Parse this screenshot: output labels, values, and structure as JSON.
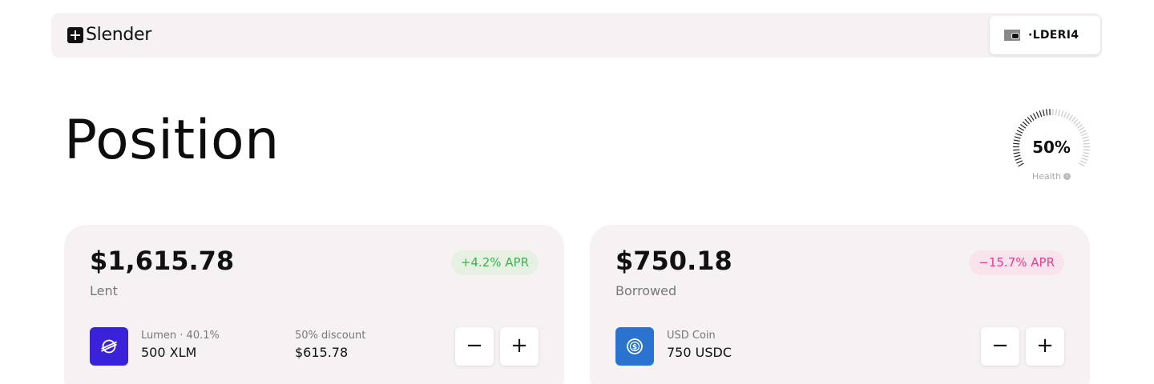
{
  "header": {
    "logo_text": "Slender",
    "wallet_address": "·LDERI4"
  },
  "page": {
    "title": "Position"
  },
  "health": {
    "value": "50%",
    "percent": 50,
    "label": "Health"
  },
  "lent": {
    "amount": "$1,615.78",
    "label": "Lent",
    "apr": "+4.2% APR",
    "asset_meta": "Lumen · 40.1%",
    "asset_amount": "500 XLM",
    "discount_label": "50% discount",
    "discount_value": "$615.78",
    "minus_label": "−",
    "plus_label": "+"
  },
  "borrowed": {
    "amount": "$750.18",
    "label": "Borrowed",
    "apr": "−15.7% APR",
    "asset_meta": "USD Coin",
    "asset_amount": "750 USDC",
    "minus_label": "−",
    "plus_label": "+"
  },
  "colors": {
    "apr_positive": "#3bb34a",
    "apr_negative": "#e0418b",
    "xlm_brand": "#3a22d9",
    "usdc_brand": "#2a74cf"
  }
}
